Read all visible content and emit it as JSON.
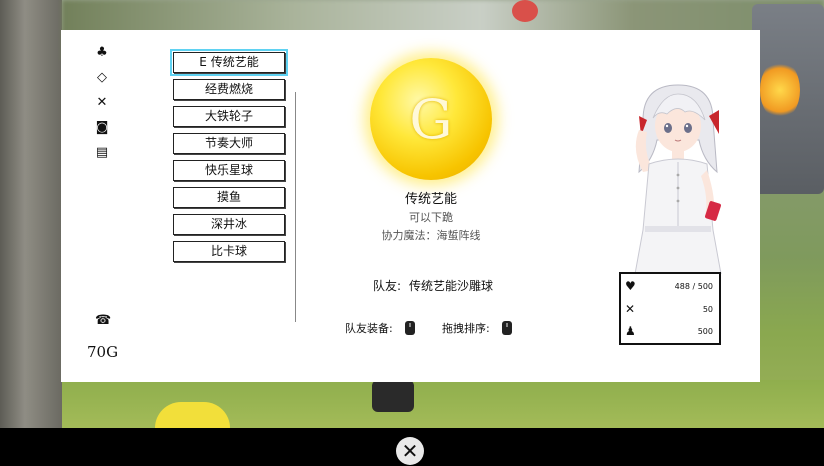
{
  "categories": [
    {
      "icon": "club-icon",
      "glyph": "♣"
    },
    {
      "icon": "diamond-icon",
      "glyph": "◇"
    },
    {
      "icon": "crossed-swords-icon",
      "glyph": "✕"
    },
    {
      "icon": "camera-icon",
      "glyph": "◙"
    },
    {
      "icon": "book-icon",
      "glyph": "▤"
    }
  ],
  "phone_glyph": "☎",
  "gold": "70G",
  "skills": [
    {
      "label": "E 传统艺能",
      "selected": true
    },
    {
      "label": "经费燃烧"
    },
    {
      "label": "大铁轮子"
    },
    {
      "label": "节奏大师"
    },
    {
      "label": "快乐星球"
    },
    {
      "label": "摸鱼"
    },
    {
      "label": "深井冰"
    },
    {
      "label": "比卡球"
    }
  ],
  "detail": {
    "coin_letter": "G",
    "name": "传统艺能",
    "subtitle": "可以下跪",
    "magic": "协力魔法：海蜇阵线",
    "teammate_label": "队友:",
    "teammate_value": "传统艺能沙雕球",
    "equip_label": "队友装备:",
    "sort_label": "拖拽排序:"
  },
  "stats": {
    "hp": "488 / 500",
    "attack": "50",
    "other": "500"
  },
  "close_glyph": "✕",
  "colors": {
    "selected_outline": "#5fd2f2",
    "coin": "#ffe83a"
  }
}
